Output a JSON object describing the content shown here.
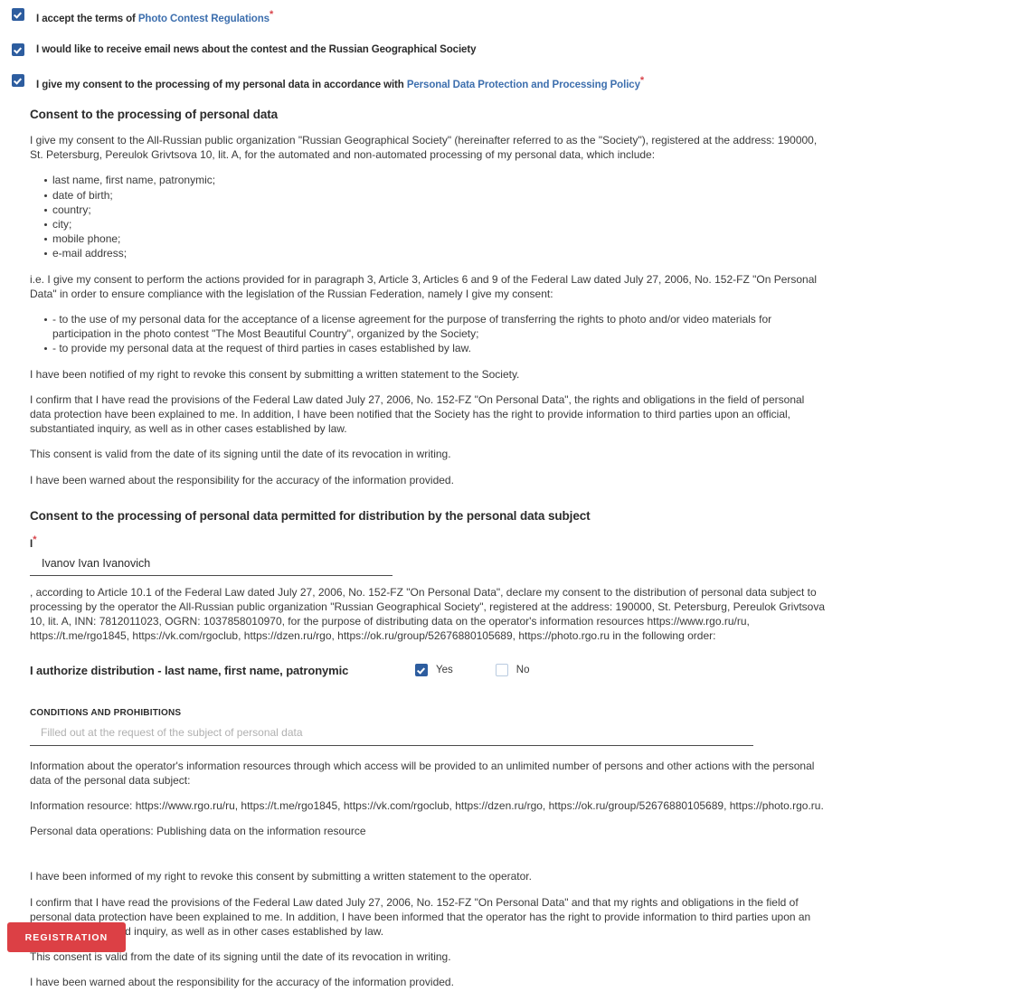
{
  "consents": [
    {
      "checked": true,
      "text_before": "I accept the terms of",
      "link": "Photo Contest Regulations",
      "required_mark": "*",
      "text_after": ""
    },
    {
      "checked": true,
      "text_before": "I would like to receive email news about the contest and the Russian Geographical Society",
      "link": "",
      "required_mark": "",
      "text_after": ""
    },
    {
      "checked": true,
      "text_before": "I give my consent to the processing of my personal data in accordance with",
      "link": "Personal Data Protection and Processing Policy",
      "required_mark": "*",
      "text_after": ""
    }
  ],
  "section1": {
    "title": "Consent to the processing of personal data",
    "intro": "I give my consent to the All-Russian public organization \"Russian Geographical Society\" (hereinafter referred to as the \"Society\"), registered at the address: 190000, St. Petersburg, Pereulok Grivtsova 10, lit. A, for the automated and non-automated processing of my personal data, which include:",
    "data_items": [
      "last name, first name, patronymic;",
      "date of birth;",
      "country;",
      "city;",
      "mobile phone;",
      "e-mail address;"
    ],
    "consent_intro": "i.e. I give my consent to perform the actions provided for in paragraph 3, Article 3, Articles 6 and 9 of the Federal Law dated July 27, 2006, No. 152-FZ \"On Personal Data\" in order to ensure compliance with the legislation of the Russian Federation, namely I give my consent:",
    "consent_items": [
      "- to the use of my personal data for the acceptance of a license agreement for the purpose of transferring the rights to photo and/or video materials for participation in the photo contest \"The Most Beautiful Country\", organized by the Society;",
      "- to provide my personal data at the request of third parties in cases established by law."
    ],
    "revoke_note": "I have been notified of my right to revoke this consent by submitting a written statement to the Society.",
    "confirm_note": "I confirm that I have read the provisions of the Federal Law dated July 27, 2006, No. 152-FZ \"On Personal Data\", the rights and obligations in the field of personal data protection have been explained to me. In addition, I have been notified that the Society has the right to provide information to third parties upon an official, substantiated inquiry, as well as in other cases established by law.",
    "validity_note": "This consent is valid from the date of its signing until the date of its revocation in writing.",
    "responsibility_note": "I have been warned about the responsibility for the accuracy of the information provided."
  },
  "section2": {
    "title": "Consent to the processing of personal data permitted for distribution by the personal data subject",
    "name_label": "I",
    "name_required_mark": "*",
    "name_value": "Ivanov Ivan Ivanovich",
    "name_placeholder": "",
    "declaration": ", according to Article 10.1 of the Federal Law dated July 27, 2006, No. 152-FZ \"On Personal Data\", declare my consent to the distribution of personal data subject to processing by the operator the All-Russian public organization \"Russian Geographical Society\", registered at the address: 190000, St. Petersburg, Pereulok Grivtsova 10, lit. A, INN: 7812011023, OGRN: 1037858010970, for the purpose of distributing data on the operator's information resources https://www.rgo.ru/ru, https://t.me/rgo1845, https://vk.com/rgoclub, https://dzen.ru/rgo, https://ok.ru/group/52676880105689, https://photo.rgo.ru in the following order:",
    "authorize_label": "I authorize distribution - last name, first name, patronymic",
    "yes_label": "Yes",
    "no_label": "No",
    "yes_checked": true,
    "no_checked": false,
    "conditions_label": "CONDITIONS AND PROHIBITIONS",
    "conditions_value": "",
    "conditions_placeholder": "Filled out at the request of the subject of personal data",
    "resources_intro": "Information about the operator's information resources through which access will be provided to an unlimited number of persons and other actions with the personal data of the personal data subject:",
    "resources_line": "Information resource: https://www.rgo.ru/ru, https://t.me/rgo1845, https://vk.com/rgoclub, https://dzen.ru/rgo, https://ok.ru/group/52676880105689, https://photo.rgo.ru.",
    "operations_line": "Personal data operations: Publishing data on the information resource",
    "revoke_note": "I have been informed of my right to revoke this consent by submitting a written statement to the operator.",
    "confirm_note": "I confirm that I have read the provisions of the Federal Law dated July 27, 2006, No. 152-FZ \"On Personal Data\" and that my rights and obligations in the field of personal data protection have been explained to me. In addition, I have been informed that the operator has the right to provide information to third parties upon an official, substantiated inquiry, as well as in other cases established by law.",
    "validity_note": "This consent is valid from the date of its signing until the date of its revocation in writing.",
    "responsibility_note": "I have been warned about the responsibility for the accuracy of the information provided."
  },
  "submit": {
    "label": "Registration"
  },
  "colors": {
    "checkbox_checked": "#2d5d9f",
    "link": "#3d6fae",
    "required": "#d8434a",
    "button": "#dc4045",
    "text": "#3a3a3a"
  }
}
